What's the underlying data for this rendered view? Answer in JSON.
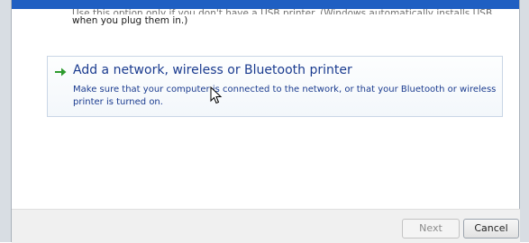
{
  "prev_option": {
    "description_line1": "Use this option only if you don't have a USB printer. (Windows automatically installs USB printers",
    "description_line2": "when you plug them in.)"
  },
  "network_option": {
    "title": "Add a network, wireless or Bluetooth printer",
    "description_line1": "Make sure that your computer is connected to the network, or that your Bluetooth or wireless",
    "description_line2": "printer is turned on."
  },
  "footer": {
    "next_label": "Next",
    "cancel_label": "Cancel"
  },
  "icons": {
    "option_arrow": "green-arrow-icon",
    "pointer": "mouse-cursor-icon"
  },
  "colors": {
    "title_bar": "#1f5fc2",
    "option_text": "#1a3b8f",
    "arrow_green": "#2e9b2e"
  }
}
